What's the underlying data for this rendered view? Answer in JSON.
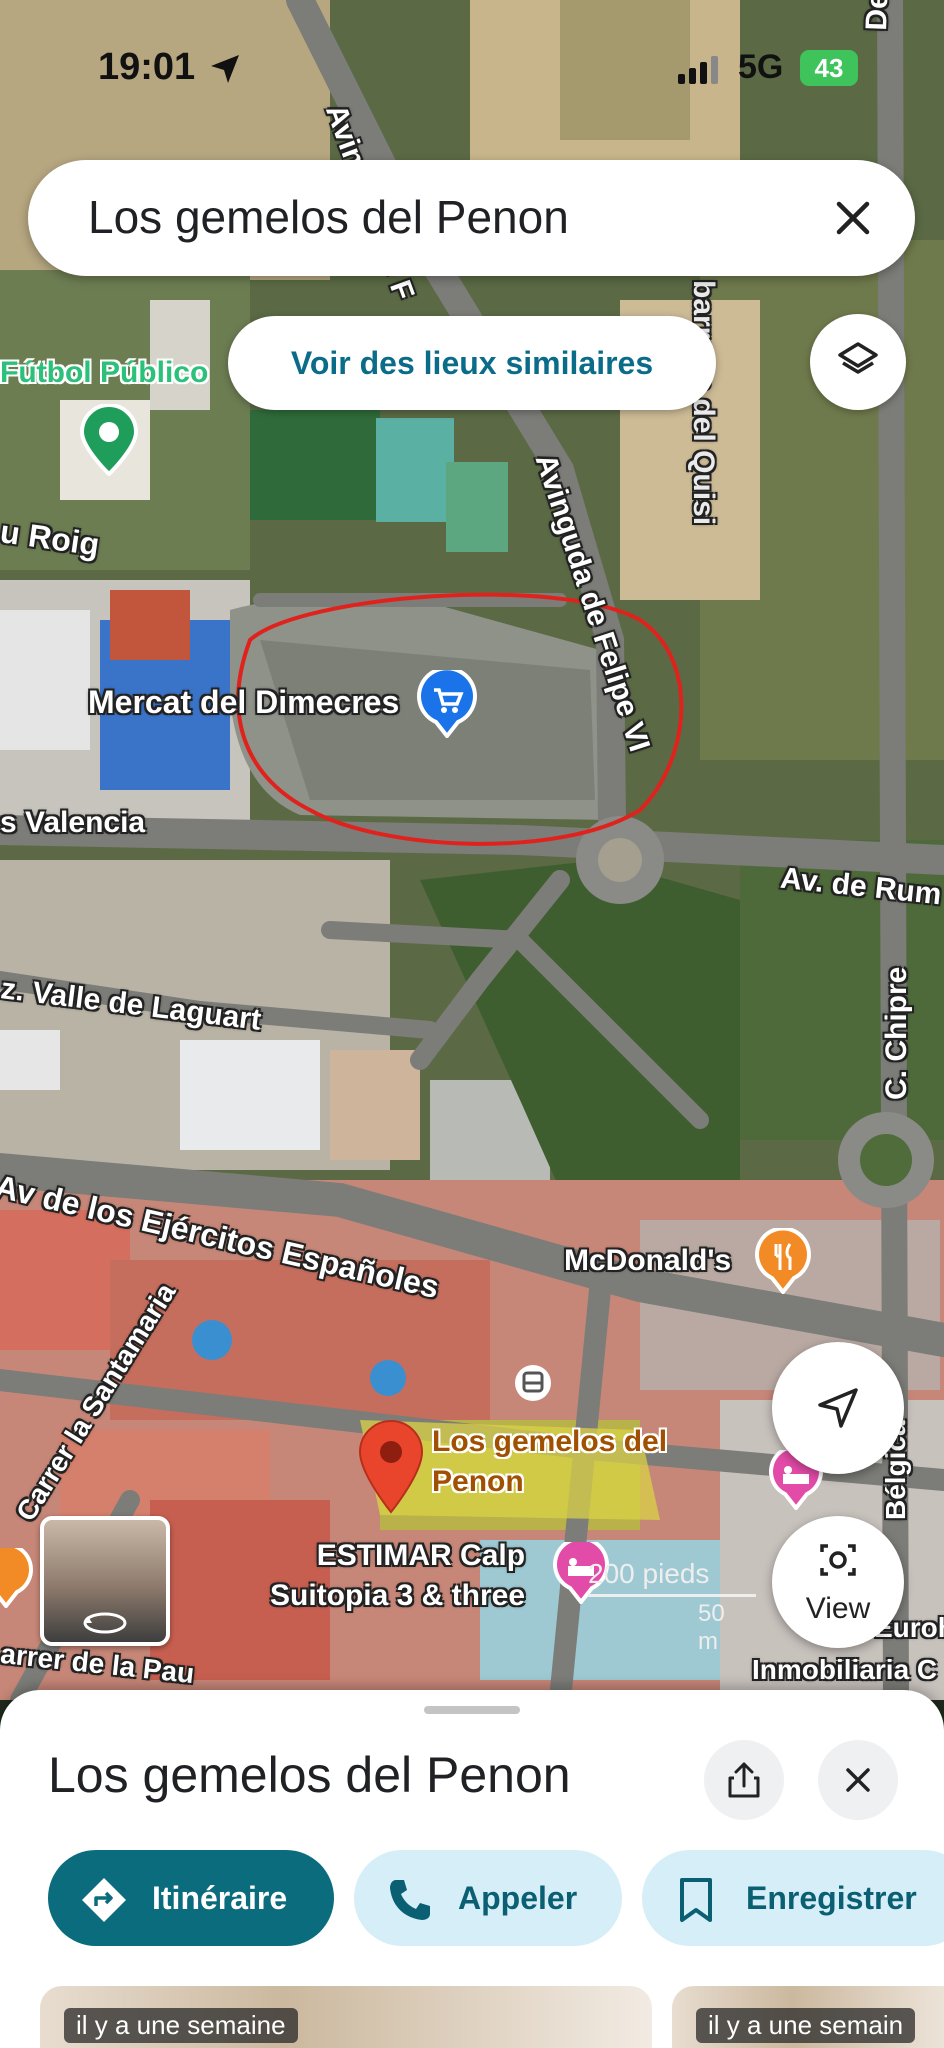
{
  "status": {
    "time": "19:01",
    "network": "5G",
    "battery": "43"
  },
  "search": {
    "query": "Los gemelos del Penon"
  },
  "similar_button": "Voir des lieux similaires",
  "map": {
    "places": {
      "futbol": "Fútbol Público",
      "mercat": "Mercat del Dimecres",
      "mcdonalds": "McDonald's",
      "selected_line1": "Los gemelos del",
      "selected_line2": "Penon",
      "estimar_line1": "ESTIMAR Calp",
      "estimar_line2": "Suitopia 3 & three",
      "inmobiliaria": "Inmobiliaria C",
      "euroh": "Euroh"
    },
    "streets": {
      "de_rusia": "De Rusia",
      "barranc": "barranc del Quisi",
      "avinguda_felipe": "Avinguda de Felipe VI",
      "avinguda_top": "Avinguda de F",
      "roig": "u Roig",
      "valencia": "s Valencia",
      "av_rum": "Av. de Rum",
      "valle": "z. Valle de Laguart",
      "chipre": "C. Chipre",
      "ejercitos": "Av de los Ejércitos Españoles",
      "santamaria": "Carrer la Santamaria",
      "pau": "arrer de la Pau",
      "belgica": "Bélgica"
    },
    "scale_label": "200 pieds",
    "scale_sub": "50 m",
    "view_label": "View"
  },
  "sheet": {
    "title": "Los gemelos del Penon",
    "actions": {
      "directions": "Itinéraire",
      "call": "Appeler",
      "save": "Enregistrer"
    },
    "photos": [
      "il y a une semaine",
      "il y a une semain"
    ]
  },
  "colors": {
    "accent": "#0b6c7e",
    "pin": "#e8452c",
    "shop_pin": "#1a73e8",
    "annotation": "#e0221d"
  }
}
